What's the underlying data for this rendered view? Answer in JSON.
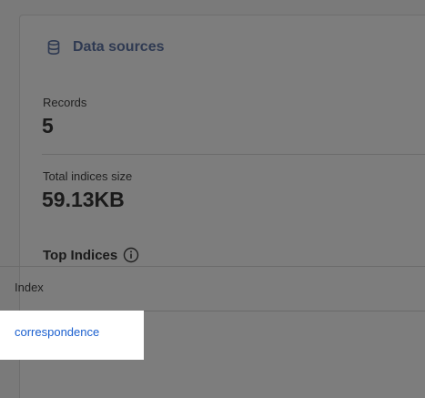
{
  "panel": {
    "title": "Data sources",
    "icon": "database-icon"
  },
  "metrics": {
    "records_label": "Records",
    "records_value": "5",
    "size_label": "Total indices size",
    "size_value": "59.13KB"
  },
  "top_indices": {
    "title": "Top Indices",
    "info_icon": "info-icon",
    "column_header": "Index",
    "rows": [
      {
        "index": "correspondence"
      }
    ]
  },
  "colors": {
    "link": "#1a5fcf",
    "overlay": "#7a7a7a",
    "highlight": "#ffffff"
  }
}
